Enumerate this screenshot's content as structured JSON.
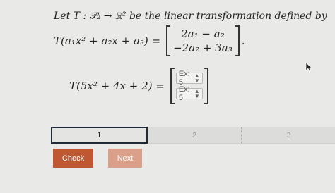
{
  "problem": {
    "intro_text": "Let T : 𝒫₂ → ℝ² be the linear transformation defined by",
    "definition_lhs": "T(a₁x² + a₂x + a₃) =",
    "definition_rows": [
      "2a₁ − a₂",
      "−2a₂ + 3a₃"
    ],
    "definition_end": ".",
    "query_lhs": "T(5x² + 4x + 2) =",
    "answer_fields": [
      {
        "placeholder": "Ex: 5"
      },
      {
        "placeholder": "Ex: 5"
      }
    ]
  },
  "progress": {
    "steps": [
      "1",
      "2",
      "3"
    ],
    "current_step": 1
  },
  "buttons": {
    "check": "Check",
    "next": "Next"
  },
  "colors": {
    "background": "#e9e9e7",
    "check_button": "#c05733",
    "next_button": "#dba08a",
    "active_step_border": "#1f2a3b"
  },
  "icons": {
    "stepper": "updown-spinner-icon",
    "cursor": "mouse-pointer-icon"
  }
}
